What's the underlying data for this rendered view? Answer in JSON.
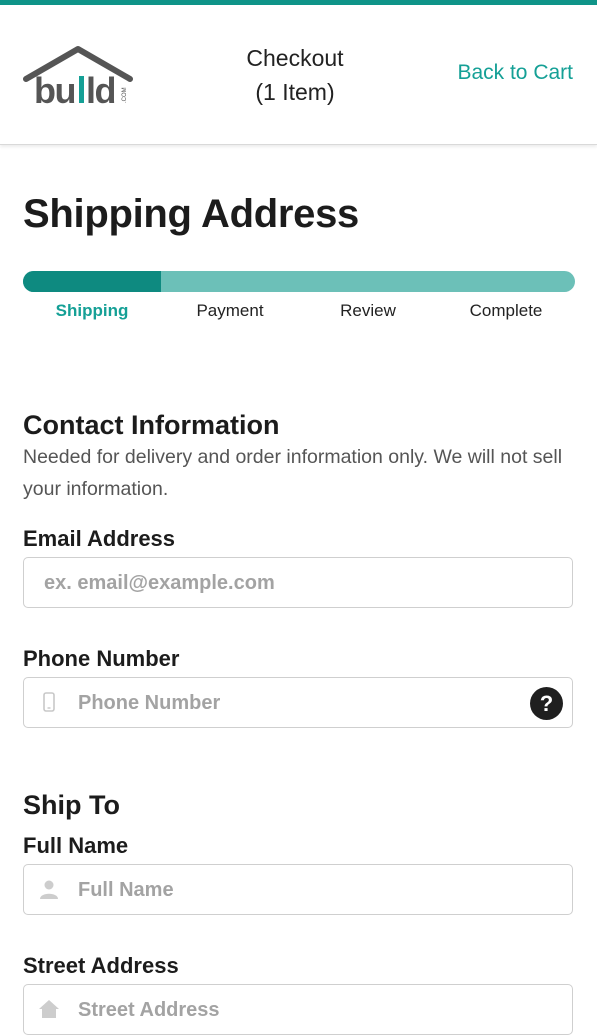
{
  "header": {
    "logo_alt": "build.com",
    "title_line1": "Checkout",
    "title_line2": "(1 Item)",
    "back_link": "Back to Cart"
  },
  "page_title": "Shipping Address",
  "progress": {
    "fraction_complete": 0.25,
    "steps": [
      "Shipping",
      "Payment",
      "Review",
      "Complete"
    ],
    "active_step": "Shipping"
  },
  "contact": {
    "title": "Contact Information",
    "description": "Needed for delivery and order information only. We will not sell your information.",
    "email_label": "Email Address",
    "email_placeholder": "ex. email@example.com",
    "phone_label": "Phone Number",
    "phone_placeholder": "Phone Number",
    "help_symbol": "?"
  },
  "ship_to": {
    "title": "Ship To",
    "name_label": "Full Name",
    "name_placeholder": "Full Name",
    "street_label": "Street Address",
    "street_placeholder": "Street Address"
  },
  "colors": {
    "accent": "#15a096",
    "progress_fill": "#0e8a80",
    "progress_track": "#6cc0b8",
    "logo_gray": "#555555",
    "logo_accent": "#15a096"
  },
  "icons": {
    "phone": "phone-icon",
    "name": "person-icon",
    "street": "home-icon",
    "help": "help-icon"
  }
}
